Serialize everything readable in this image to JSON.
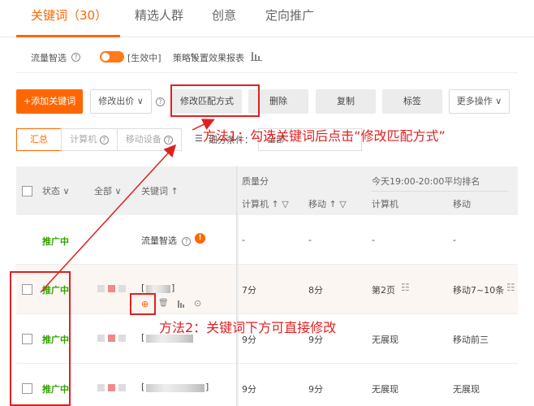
{
  "tabs": [
    {
      "label": "关键词（30）",
      "active": true
    },
    {
      "label": "精选人群"
    },
    {
      "label": "创意"
    },
    {
      "label": "定向推广"
    }
  ],
  "subbar": {
    "smart": "流量智选",
    "status": "[生效中]",
    "strategy": "策略设置",
    "report": "效果报表"
  },
  "toolbar": {
    "add": "+添加关键词",
    "bid": "修改出价",
    "match": "修改匹配方式",
    "delete": "删除",
    "copy": "复制",
    "tag": "标签",
    "more": "更多操作"
  },
  "segments": {
    "summary": "汇总",
    "computer": "计算机",
    "mobile": "移动设备",
    "filter_label": "细分条件：",
    "filter_value": "全部"
  },
  "table": {
    "headers": {
      "status": "状态",
      "all": "全部",
      "keyword": "关键词",
      "quality": "质量分",
      "quality_pc": "计算机",
      "quality_mobile": "移动",
      "rank": "今天19:00-20:00平均排名",
      "rank_pc": "计算机",
      "rank_mobile": "移动"
    },
    "rows": [
      {
        "status": "推广中",
        "keyword": "流量智选",
        "q_pc": "-",
        "q_mobile": "-",
        "r_pc": "-",
        "r_mobile": "-"
      },
      {
        "status": "推广中",
        "keyword": "[",
        "keyword_end": "]",
        "q_pc": "7分",
        "q_mobile": "8分",
        "r_pc": "第2页",
        "r_mobile": "移动7~10条"
      },
      {
        "status": "推广中",
        "keyword": "[",
        "keyword_end": "",
        "q_pc": "9分",
        "q_mobile": "9分",
        "r_pc": "无展现",
        "r_mobile": "移动前三"
      },
      {
        "status": "推广中",
        "keyword": "[",
        "keyword_end": "]",
        "q_pc": "9分",
        "q_mobile": "9分",
        "r_pc": "无展现",
        "r_mobile": "无展现"
      }
    ]
  },
  "annotations": {
    "method1": "方法1：勾选关键词后点击“修改匹配方式”",
    "method2": "方法2：关键词下方可直接修改"
  },
  "colors": {
    "accent": "#ff6600",
    "status_green": "#33a300",
    "annotation_red": "#e02020"
  },
  "icons": [
    "help-icon",
    "toggle-switch",
    "pencil-icon",
    "bar-chart-icon",
    "chevron-down-icon",
    "sort-up-icon",
    "filter-icon",
    "edit-match-icon",
    "trash-icon",
    "report-icon",
    "more-icon",
    "info-icon",
    "rank-list-icon"
  ]
}
